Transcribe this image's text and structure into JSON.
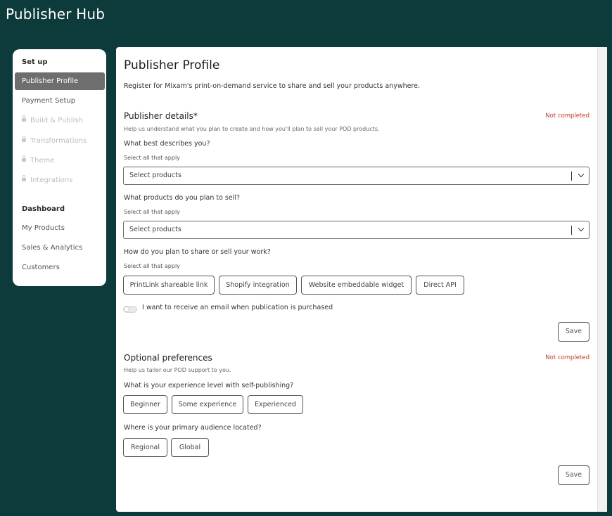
{
  "app": {
    "title": "Publisher Hub"
  },
  "sidebar": {
    "setup_heading": "Set up",
    "setup_items": [
      {
        "label": "Publisher Profile",
        "state": "active"
      },
      {
        "label": "Payment Setup",
        "state": "normal"
      },
      {
        "label": "Build & Publish",
        "state": "locked"
      },
      {
        "label": "Transformations",
        "state": "locked"
      },
      {
        "label": "Theme",
        "state": "locked"
      },
      {
        "label": "Integrations",
        "state": "locked"
      }
    ],
    "dashboard_heading": "Dashboard",
    "dashboard_items": [
      {
        "label": "My Products"
      },
      {
        "label": "Sales & Analytics"
      },
      {
        "label": "Customers"
      }
    ]
  },
  "main": {
    "title": "Publisher Profile",
    "intro": "Register for Mixam's print-on-demand service to share and sell your products anywhere.",
    "publisher_details": {
      "title": "Publisher details*",
      "status": "Not completed",
      "subtitle": "Help us understand what you plan to create and how you'll plan to sell your POD products.",
      "q1": {
        "question": "What best describes you?",
        "hint": "Select all that apply",
        "placeholder": "Select products"
      },
      "q2": {
        "question": "What products do you plan to sell?",
        "hint": "Select all that apply",
        "placeholder": "Select products"
      },
      "q3": {
        "question": "How do you plan to share or sell your work?",
        "hint": "Select all that apply",
        "options": [
          "PrintLink shareable link",
          "Shopify integration",
          "Website embeddable widget",
          "Direct API"
        ]
      },
      "toggle_label": "I want to receive an email when publication is purchased",
      "save_label": "Save"
    },
    "optional_preferences": {
      "title": "Optional preferences",
      "status": "Not completed",
      "subtitle": "Help us tailor our POD support to you.",
      "q1": {
        "question": "What is your experience level with self-publishing?",
        "options": [
          "Beginner",
          "Some experience",
          "Experienced"
        ]
      },
      "q2": {
        "question": "Where is your primary audience located?",
        "options": [
          "Regional",
          "Global"
        ]
      },
      "save_label": "Save"
    }
  },
  "colors": {
    "background": "#0d3b3c",
    "active_item": "#6e6e6e",
    "status": "#c0392b"
  }
}
